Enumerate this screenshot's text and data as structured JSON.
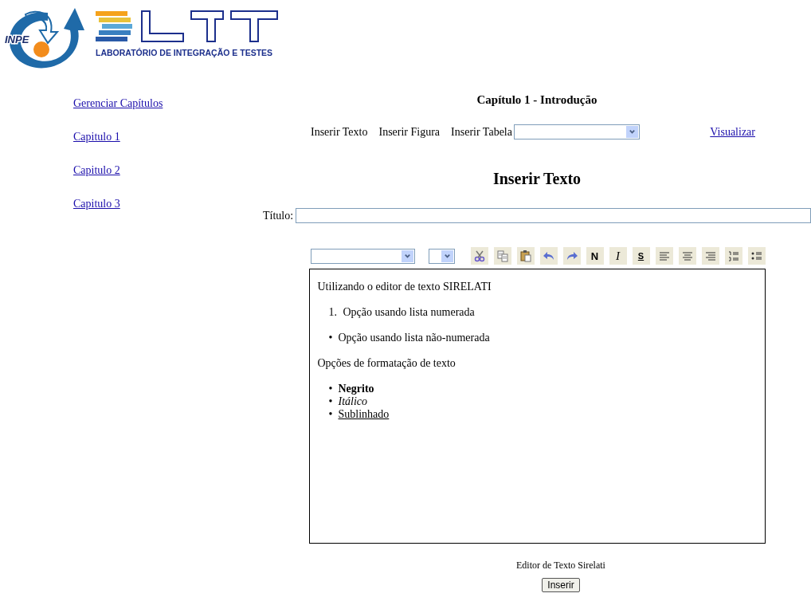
{
  "header": {
    "badge": "INPE",
    "subtitle": "LABORATÓRIO DE INTEGRAÇÃO E TESTES"
  },
  "sidebar": {
    "items": [
      {
        "label": "Gerenciar Capítulos"
      },
      {
        "label": "Capitulo 1"
      },
      {
        "label": "Capitulo 2"
      },
      {
        "label": "Capitulo 3"
      }
    ]
  },
  "chapter_title": "Capítulo 1 - Introdução",
  "actions": [
    {
      "kind": "text",
      "label": "Inserir Texto"
    },
    {
      "kind": "text",
      "label": "Inserir Figura"
    },
    {
      "kind": "select",
      "label": "Inserir Tabela"
    },
    {
      "kind": "link",
      "label": "Visualizar"
    }
  ],
  "section_title": "Inserir Texto",
  "title_field": {
    "label": "Título:"
  },
  "toolbar": [
    {
      "kind": "cut"
    },
    {
      "kind": "copy"
    },
    {
      "kind": "paste"
    },
    {
      "kind": "undo"
    },
    {
      "kind": "redo"
    },
    {
      "kind": "bold",
      "label": "N"
    },
    {
      "kind": "italic",
      "label": "I"
    },
    {
      "kind": "underline",
      "label": "S"
    },
    {
      "kind": "align-left"
    },
    {
      "kind": "align-center"
    },
    {
      "kind": "align-right"
    },
    {
      "kind": "numbered-list"
    },
    {
      "kind": "bulleted-list"
    }
  ],
  "editor": {
    "content": [
      {
        "kind": "paragraph",
        "text": "Utilizando o editor de texto SIRELATI"
      },
      {
        "kind": "list",
        "items": [
          {
            "marker": "1.",
            "text": "Opção usando lista numerada",
            "kind": "plain"
          }
        ]
      },
      {
        "kind": "list",
        "items": [
          {
            "marker": "•",
            "text": "Opção usando lista não-numerada",
            "kind": "plain"
          }
        ]
      },
      {
        "kind": "paragraph",
        "text": "Opções de formatação de texto"
      },
      {
        "kind": "list",
        "items": [
          {
            "marker": "•",
            "text": "Negrito",
            "kind": "bold"
          },
          {
            "marker": "•",
            "text": "Itálico",
            "kind": "italic"
          },
          {
            "marker": "•",
            "text": "Sublinhado",
            "kind": "underline"
          }
        ]
      }
    ]
  },
  "caption": "Editor de Texto Sirelati",
  "submit": {
    "label": "Inserir"
  }
}
